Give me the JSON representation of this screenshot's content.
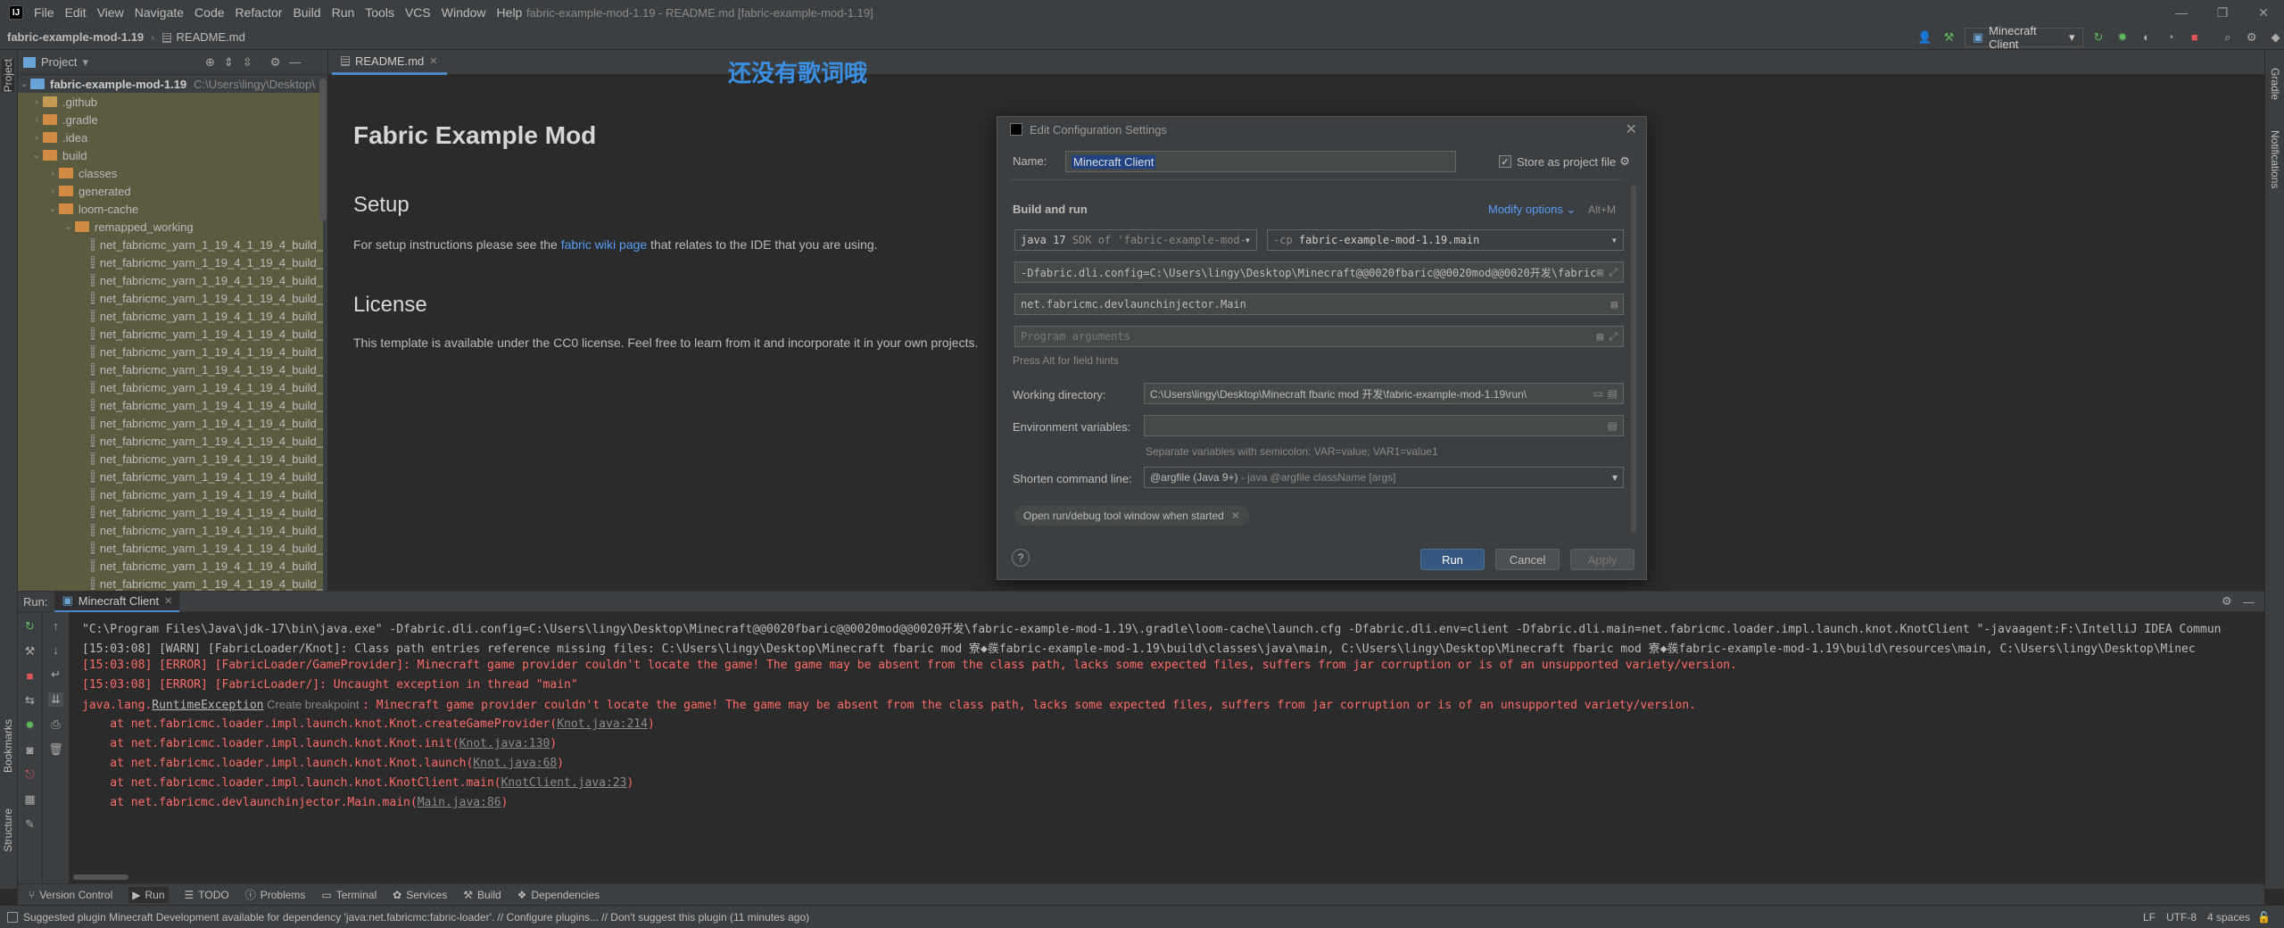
{
  "menubar": {
    "items": [
      "File",
      "Edit",
      "View",
      "Navigate",
      "Code",
      "Refactor",
      "Build",
      "Run",
      "Tools",
      "VCS",
      "Window",
      "Help"
    ],
    "window_title": "fabric-example-mod-1.19 - README.md [fabric-example-mod-1.19]"
  },
  "navbar": {
    "project": "fabric-example-mod-1.19",
    "file": "README.md",
    "run_config": "Minecraft Client"
  },
  "left_strip": {
    "project_tab": "Project",
    "bookmarks_tab": "Bookmarks",
    "structure_tab": "Structure"
  },
  "right_strip": {
    "gradle_tab": "Gradle",
    "notifications_tab": "Notifications"
  },
  "project_panel": {
    "title": "Project",
    "root": {
      "name": "fabric-example-mod-1.19",
      "path": "C:\\Users\\lingy\\Desktop\\"
    },
    "folders": [
      ".github",
      ".gradle",
      ".idea",
      "build",
      "classes",
      "generated",
      "loom-cache",
      "remapped_working"
    ],
    "file_item": "net_fabricmc_yarn_1_19_4_1_19_4_build_"
  },
  "editor": {
    "tab": "README.md",
    "h1": "Fabric Example Mod",
    "setup_heading": "Setup",
    "setup_prefix": "For setup instructions please see the ",
    "setup_link": "fabric wiki page",
    "setup_suffix": " that relates to the IDE that you are using.",
    "license_heading": "License",
    "license_text": "This template is available under the CC0 license. Feel free to learn from it and incorporate it in your own projects."
  },
  "lyrics_overlay": "还没有歌词哦",
  "dialog": {
    "title": "Edit Configuration Settings",
    "name_label": "Name:",
    "name_value": "Minecraft Client",
    "store_label": "Store as project file",
    "build_and_run": "Build and run",
    "modify_options": "Modify options",
    "modify_shortcut": "Alt+M",
    "jdk_prefix": "java 17",
    "jdk_value": "SDK of 'fabric-example-mod-",
    "cp_prefix": "-cp",
    "cp_value": "fabric-example-mod-1.19.main",
    "vm_options": "-Dfabric.dli.config=C:\\Users\\lingy\\Desktop\\Minecraft@@0020fbaric@@0020mod@@0020开发\\fabric-",
    "main_class": "net.fabricmc.devlaunchinjector.Main",
    "program_args_placeholder": "Program arguments",
    "alt_hint": "Press Alt for field hints",
    "workdir_label": "Working directory:",
    "workdir_value": "C:\\Users\\lingy\\Desktop\\Minecraft fbaric mod 开发\\fabric-example-mod-1.19\\run\\",
    "env_label": "Environment variables:",
    "env_hint": "Separate variables with semicolon: VAR=value; VAR1=value1",
    "shorten_label": "Shorten command line:",
    "shorten_value": "@argfile (Java 9+)",
    "shorten_hint": "- java @argfile className [args]",
    "open_tool_window": "Open run/debug tool window when started",
    "run": "Run",
    "cancel": "Cancel",
    "apply": "Apply",
    "help": "?"
  },
  "run_panel": {
    "label": "Run:",
    "tab": "Minecraft Client"
  },
  "console": {
    "line1": "\"C:\\Program Files\\Java\\jdk-17\\bin\\java.exe\" -Dfabric.dli.config=C:\\Users\\lingy\\Desktop\\Minecraft@@0020fbaric@@0020mod@@0020开发\\fabric-example-mod-1.19\\.gradle\\loom-cache\\launch.cfg -Dfabric.dli.env=client -Dfabric.dli.main=net.fabricmc.loader.impl.launch.knot.KnotClient \"-javaagent:F:\\IntelliJ IDEA Commun",
    "line2": "[15:03:08] [WARN] [FabricLoader/Knot]: Class path entries reference missing files: C:\\Users\\lingy\\Desktop\\Minecraft fbaric mod 寮◆彂fabric-example-mod-1.19\\build\\classes\\java\\main, C:\\Users\\lingy\\Desktop\\Minecraft fbaric mod 寮◆彂fabric-example-mod-1.19\\build\\resources\\main, C:\\Users\\lingy\\Desktop\\Minec",
    "line3": "[15:03:08] [ERROR] [FabricLoader/GameProvider]: Minecraft game provider couldn't locate the game! The game may be absent from the class path, lacks some expected files, suffers from jar corruption or is of an unsupported variety/version.",
    "line4": "[15:03:08] [ERROR] [FabricLoader/]: Uncaught exception in thread \"main\"",
    "line5_prefix": "java.lang.",
    "line5_exc": "RuntimeException",
    "line5_bp": " Create breakpoint ",
    "line5_rest": ": Minecraft game provider couldn't locate the game! The game may be absent from the class path, lacks some expected files, suffers from jar corruption or is of an unsupported variety/version.",
    "frames": [
      {
        "text": "    at net.fabricmc.loader.impl.launch.knot.Knot.createGameProvider(",
        "link": "Knot.java:214",
        "end": ")"
      },
      {
        "text": "    at net.fabricmc.loader.impl.launch.knot.Knot.init(",
        "link": "Knot.java:130",
        "end": ")"
      },
      {
        "text": "    at net.fabricmc.loader.impl.launch.knot.Knot.launch(",
        "link": "Knot.java:68",
        "end": ")"
      },
      {
        "text": "    at net.fabricmc.loader.impl.launch.knot.KnotClient.main(",
        "link": "KnotClient.java:23",
        "end": ")"
      },
      {
        "text": "    at net.fabricmc.devlaunchinjector.Main.main(",
        "link": "Main.java:86",
        "end": ")"
      }
    ]
  },
  "tool_tabs": [
    "Version Control",
    "Run",
    "TODO",
    "Problems",
    "Terminal",
    "Services",
    "Build",
    "Dependencies"
  ],
  "statusbar": {
    "message": "Suggested plugin Minecraft Development available for dependency 'java:net.fabricmc:fabric-loader'. // Configure plugins... // Don't suggest this plugin (11 minutes ago)",
    "line_sep": "LF",
    "encoding": "UTF-8",
    "indent": "4 spaces"
  }
}
